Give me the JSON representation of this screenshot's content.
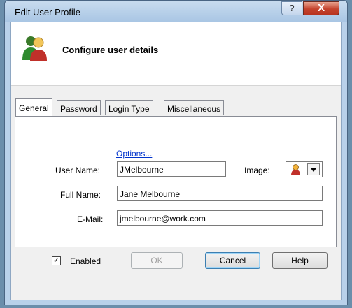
{
  "window": {
    "title": "Edit User Profile",
    "help_glyph": "?",
    "close_glyph": "X"
  },
  "header": {
    "title": "Configure user details",
    "icon": "users-icon"
  },
  "tabs": [
    {
      "label": "General",
      "active": true
    },
    {
      "label": "Password",
      "active": false
    },
    {
      "label": "Login Type",
      "active": false
    },
    {
      "label": "Miscellaneous",
      "active": false
    }
  ],
  "form": {
    "user_name_label": "User Name:",
    "user_name_value": "JMelbourne",
    "image_label": "Image:",
    "image_icon": "female-user-icon",
    "full_name_label": "Full Name:",
    "full_name_value": "Jane Melbourne",
    "email_label": "E-Mail:",
    "email_value": "jmelbourne@work.com",
    "options_link": "Options..."
  },
  "footer": {
    "enabled_label": "Enabled",
    "enabled_checked": true,
    "ok_label": "OK",
    "cancel_label": "Cancel",
    "help_label": "Help"
  }
}
